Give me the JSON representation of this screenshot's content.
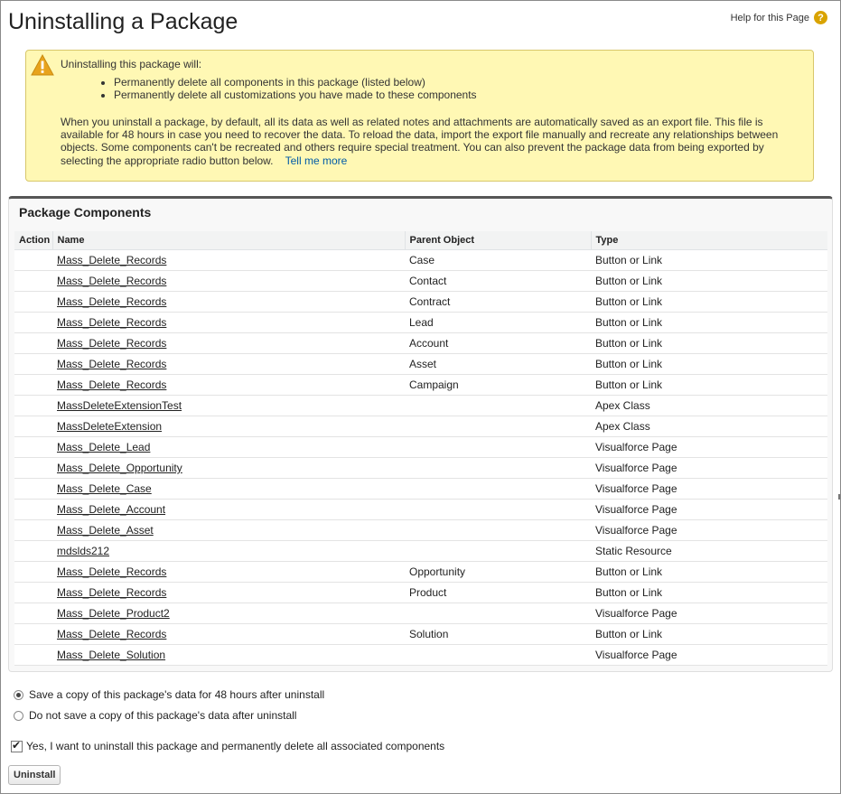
{
  "page": {
    "title": "Uninstalling a Package",
    "help_label": "Help for this Page",
    "help_icon": "?"
  },
  "warning": {
    "heading": "Uninstalling this package will:",
    "bullets": [
      "Permanently delete all components in this package (listed below)",
      "Permanently delete all customizations you have made to these components"
    ],
    "body": "When you uninstall a package, by default, all its data as well as related notes and attachments are automatically saved as an export file. This file is available for 48 hours in case you need to recover the data. To reload the data, import the export file manually and recreate any relationships between objects. Some components can't be recreated and others require special treatment. You can also prevent the package data from being exported by selecting the appropriate radio button below.",
    "link_label": "Tell me more",
    "icon": "warning-triangle-icon"
  },
  "components": {
    "title": "Package Components",
    "columns": [
      "Action",
      "Name",
      "Parent Object",
      "Type"
    ],
    "rows": [
      {
        "name": "Mass_Delete_Records",
        "parent": "Case",
        "type": "Button or Link"
      },
      {
        "name": "Mass_Delete_Records",
        "parent": "Contact",
        "type": "Button or Link"
      },
      {
        "name": "Mass_Delete_Records",
        "parent": "Contract",
        "type": "Button or Link"
      },
      {
        "name": "Mass_Delete_Records",
        "parent": "Lead",
        "type": "Button or Link"
      },
      {
        "name": "Mass_Delete_Records",
        "parent": "Account",
        "type": "Button or Link"
      },
      {
        "name": "Mass_Delete_Records",
        "parent": "Asset",
        "type": "Button or Link"
      },
      {
        "name": "Mass_Delete_Records",
        "parent": "Campaign",
        "type": "Button or Link"
      },
      {
        "name": "MassDeleteExtensionTest",
        "parent": "",
        "type": "Apex Class"
      },
      {
        "name": "MassDeleteExtension",
        "parent": "",
        "type": "Apex Class"
      },
      {
        "name": "Mass_Delete_Lead",
        "parent": "",
        "type": "Visualforce Page"
      },
      {
        "name": "Mass_Delete_Opportunity",
        "parent": "",
        "type": "Visualforce Page"
      },
      {
        "name": "Mass_Delete_Case",
        "parent": "",
        "type": "Visualforce Page"
      },
      {
        "name": "Mass_Delete_Account",
        "parent": "",
        "type": "Visualforce Page"
      },
      {
        "name": "Mass_Delete_Asset",
        "parent": "",
        "type": "Visualforce Page"
      },
      {
        "name": "mdslds212",
        "parent": "",
        "type": "Static Resource"
      },
      {
        "name": "Mass_Delete_Records",
        "parent": "Opportunity",
        "type": "Button or Link"
      },
      {
        "name": "Mass_Delete_Records",
        "parent": "Product",
        "type": "Button or Link"
      },
      {
        "name": "Mass_Delete_Product2",
        "parent": "",
        "type": "Visualforce Page"
      },
      {
        "name": "Mass_Delete_Records",
        "parent": "Solution",
        "type": "Button or Link"
      },
      {
        "name": "Mass_Delete_Solution",
        "parent": "",
        "type": "Visualforce Page"
      }
    ]
  },
  "options": {
    "save_copy": "Save a copy of this package's data for 48 hours after uninstall",
    "no_copy": "Do not save a copy of this package's data after uninstall",
    "selected": "save_copy"
  },
  "confirm": {
    "label": "Yes, I want to uninstall this package and permanently delete all associated components",
    "checked": true
  },
  "actions": {
    "uninstall_label": "Uninstall"
  },
  "colors": {
    "warning_bg": "#fff8b4",
    "link": "#015ba7",
    "help_icon": "#d9a300"
  }
}
